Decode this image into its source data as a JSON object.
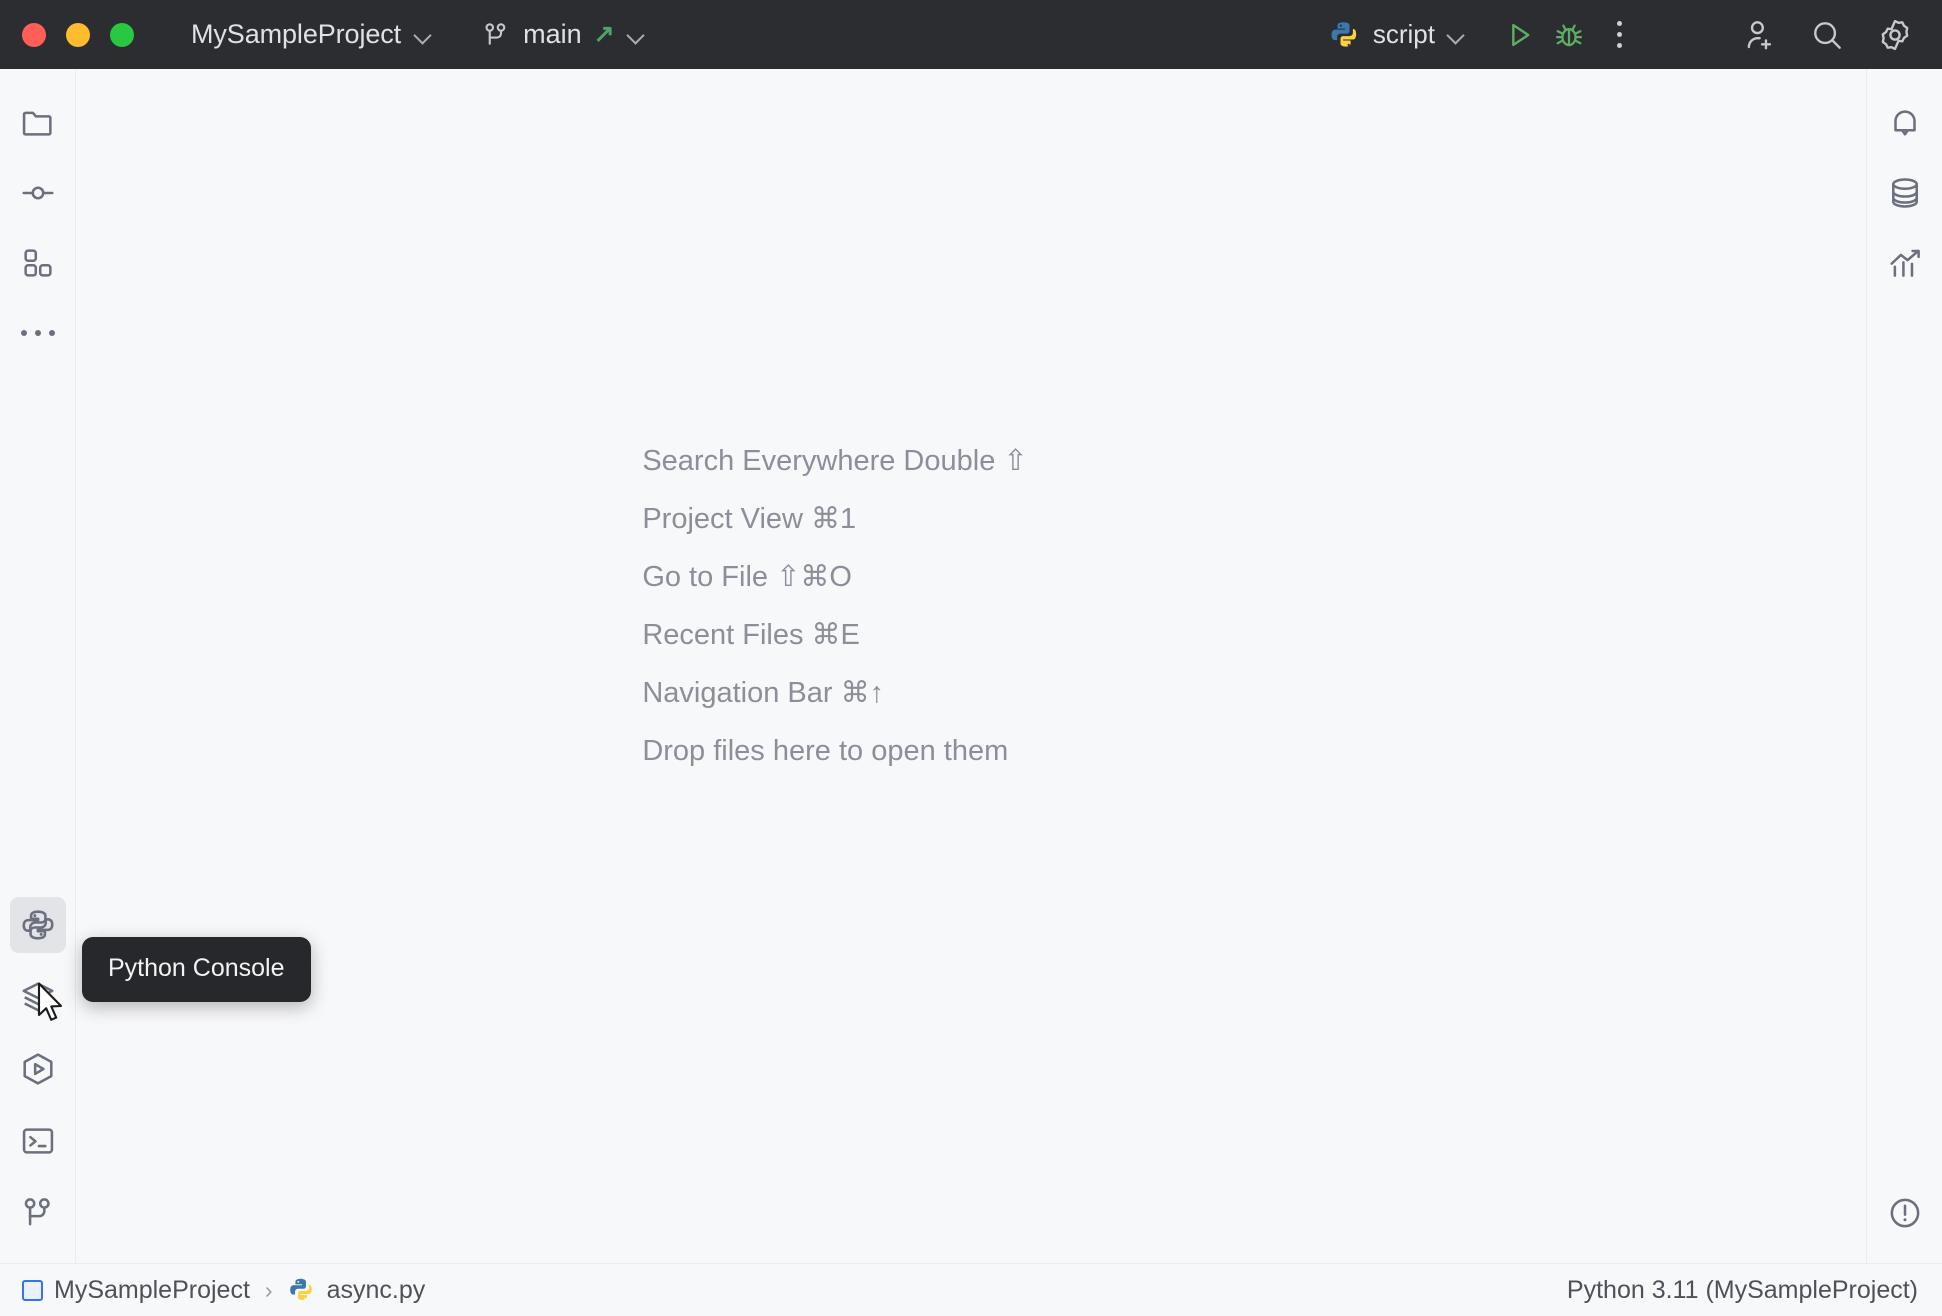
{
  "window": {
    "traffic_lights": [
      {
        "name": "close",
        "color": "#ff5f57"
      },
      {
        "name": "minimize",
        "color": "#febc2e"
      },
      {
        "name": "maximize",
        "color": "#28c840"
      }
    ]
  },
  "titlebar": {
    "project_name": "MySampleProject",
    "branch_name": "main",
    "branch_push_indicator": "↗",
    "run_config_name": "script",
    "run_config_icon": "python-logo-icon",
    "actions": [
      {
        "name": "run-button",
        "icon": "play-icon",
        "color": "#5fad65"
      },
      {
        "name": "debug-button",
        "icon": "bug-icon",
        "color": "#5fad65"
      },
      {
        "name": "more-actions-button",
        "icon": "more-vertical-icon"
      }
    ],
    "right_actions": [
      {
        "name": "add-user-button",
        "icon": "user-plus-icon"
      },
      {
        "name": "search-everywhere-button",
        "icon": "search-icon"
      },
      {
        "name": "settings-button",
        "icon": "gear-icon"
      }
    ]
  },
  "left_stripe": {
    "top_items": [
      {
        "name": "project-tool-window",
        "icon": "folder-icon",
        "label": "Project"
      },
      {
        "name": "commit-tool-window",
        "icon": "commit-icon",
        "label": "Commit"
      },
      {
        "name": "plugins-tool-window",
        "icon": "plugins-icon",
        "label": "Plugins"
      },
      {
        "name": "more-tool-windows",
        "icon": "more-horizontal-icon",
        "label": "More Tool Windows"
      }
    ],
    "bottom_items": [
      {
        "name": "python-console-tool-window",
        "icon": "python-console-icon",
        "label": "Python Console",
        "hovered": true
      },
      {
        "name": "python-packages-tool-window",
        "icon": "layers-icon",
        "label": "Python Packages"
      },
      {
        "name": "run-tool-window",
        "icon": "run-hexagon-icon",
        "label": "Run"
      },
      {
        "name": "terminal-tool-window",
        "icon": "terminal-icon",
        "label": "Terminal"
      },
      {
        "name": "version-control-tool-window",
        "icon": "git-branch-icon",
        "label": "Version Control"
      }
    ]
  },
  "right_stripe": {
    "top_items": [
      {
        "name": "notifications-tool-window",
        "icon": "bell-icon",
        "label": "Notifications"
      },
      {
        "name": "database-tool-window",
        "icon": "database-icon",
        "label": "Database"
      },
      {
        "name": "plots-tool-window",
        "icon": "chart-icon",
        "label": "Plots"
      }
    ],
    "bottom_items": [
      {
        "name": "problems-tool-window",
        "icon": "exclamation-circle-icon",
        "label": "Problems"
      }
    ]
  },
  "editor": {
    "hints": [
      "Search Everywhere Double ⇧",
      "Project View ⌘1",
      "Go to File ⇧⌘O",
      "Recent Files ⌘E",
      "Navigation Bar ⌘↑",
      "Drop files here to open them"
    ]
  },
  "tooltip": {
    "text": "Python Console",
    "visible": true
  },
  "statusbar": {
    "breadcrumb": [
      {
        "name": "breadcrumb-project",
        "label": "MySampleProject",
        "icon": "project-square-icon"
      },
      {
        "name": "breadcrumb-file",
        "label": "async.py",
        "icon": "python-file-icon"
      }
    ],
    "separator": "›",
    "interpreter": "Python 3.11 (MySampleProject)"
  },
  "colors": {
    "titlebar_bg": "#2b2d30",
    "editor_bg": "#f7f8fa",
    "stripe_bg": "#f7f8fa",
    "divider": "#ebecf0",
    "accent_green": "#5fad65",
    "accent_blue": "#3574f0",
    "hint_text": "#8c8f99",
    "icon_gray": "#6c707e",
    "tooltip_bg": "#27282b"
  }
}
